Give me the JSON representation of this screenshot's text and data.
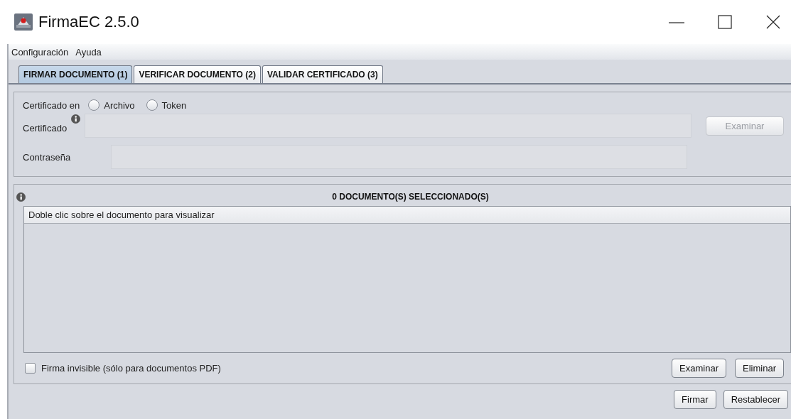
{
  "window": {
    "title": "FirmaEC 2.5.0"
  },
  "menu": [
    {
      "label": "Configuración"
    },
    {
      "label": "Ayuda"
    }
  ],
  "tabs": [
    {
      "label": "FIRMAR DOCUMENTO (1)",
      "selected": true
    },
    {
      "label": "VERIFICAR DOCUMENTO (2)",
      "selected": false
    },
    {
      "label": "VALIDAR CERTIFICADO (3)",
      "selected": false
    }
  ],
  "certificate": {
    "source_label": "Certificado en",
    "sources": [
      {
        "label": "Archivo",
        "selected": false
      },
      {
        "label": "Token",
        "selected": false
      }
    ],
    "certificate_label": "Certificado",
    "certificate_field": {
      "disabled": true
    },
    "browse_button": {
      "label": "Examinar",
      "disabled": true
    },
    "password_label": "Contraseña",
    "password_field": {
      "disabled": true
    }
  },
  "documents": {
    "heading": "0 DOCUMENTO(S) SELECCIONADO(S)",
    "list_header": "Doble clic sobre el documento para visualizar",
    "invisible_signature": {
      "label": "Firma invisible (sólo para documentos PDF)",
      "checked": false
    },
    "buttons": [
      {
        "label": "Examinar",
        "disabled": false
      },
      {
        "label": "Eliminar",
        "disabled": false
      }
    ]
  },
  "footer_buttons": [
    {
      "label": "Firmar",
      "disabled": false
    },
    {
      "label": "Restablecer",
      "disabled": false
    }
  ]
}
